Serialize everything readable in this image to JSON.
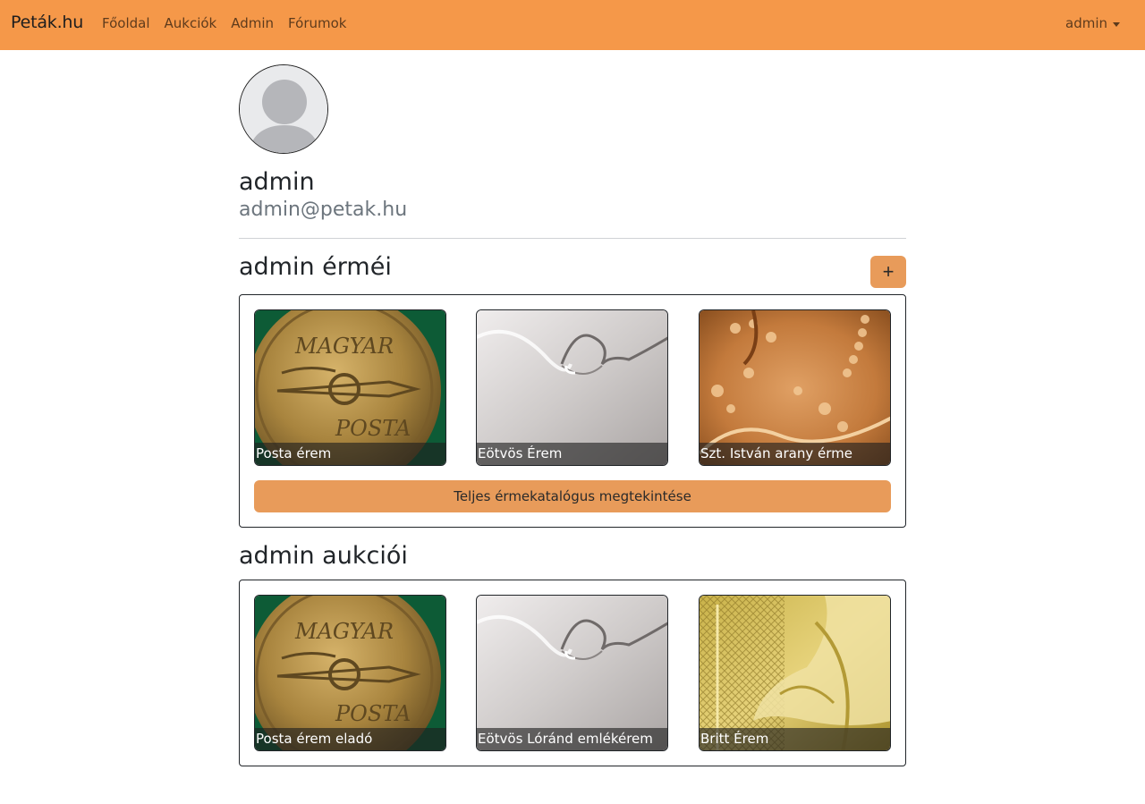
{
  "navbar": {
    "brand": "Peták.hu",
    "links": [
      "Főoldal",
      "Aukciók",
      "Admin",
      "Fórumok"
    ],
    "user_menu": "admin"
  },
  "profile": {
    "username": "admin",
    "email": "admin@petak.hu"
  },
  "coins_section": {
    "title": "admin érméi",
    "add_button": "+",
    "items": [
      {
        "label": "Posta érem",
        "image": "posta-coin"
      },
      {
        "label": "Eötvös Érem",
        "image": "eotvos-coin"
      },
      {
        "label": "Szt. István arany érme",
        "image": "gold-coin"
      }
    ],
    "catalog_button": "Teljes érmekatalógus megtekintése"
  },
  "auctions_section": {
    "title": "admin aukciói",
    "items": [
      {
        "label": "Posta érem eladó",
        "image": "posta-coin"
      },
      {
        "label": "Eötvös Lóránd emlékérem",
        "image": "eotvos-coin"
      },
      {
        "label": "Britt Érem",
        "image": "britannia-coin"
      }
    ]
  },
  "colors": {
    "navbar": "#f59849",
    "button": "#e89b5a"
  }
}
